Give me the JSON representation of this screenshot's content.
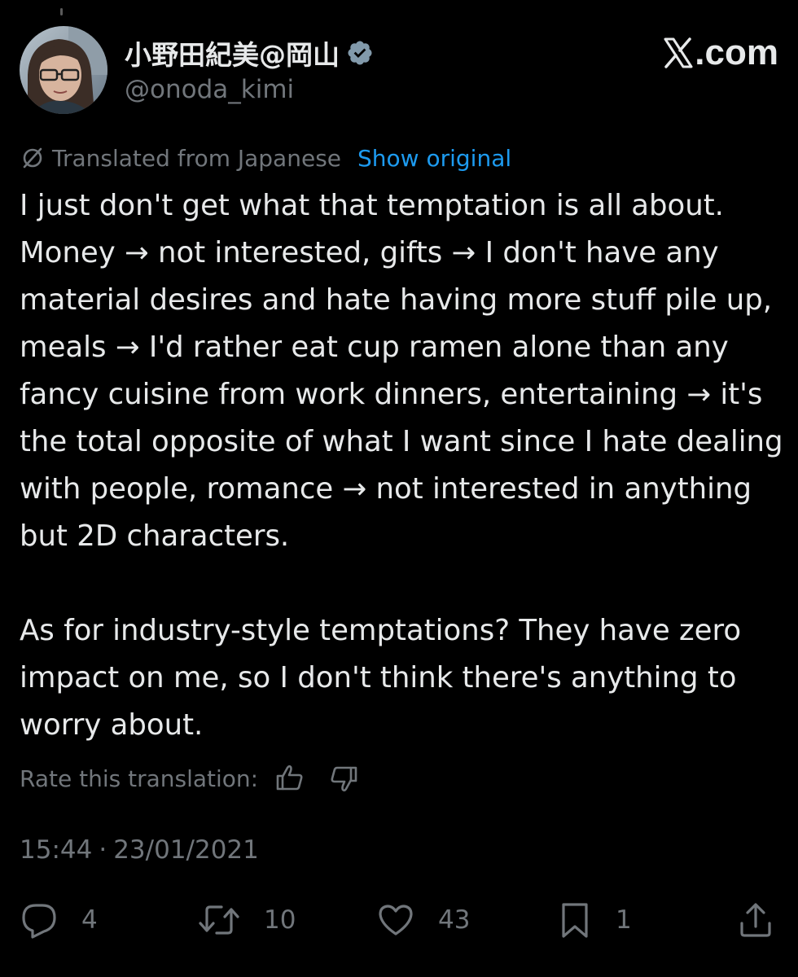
{
  "author": {
    "display_name": "小野田紀美@岡山",
    "handle": "@onoda_kimi",
    "verified": true
  },
  "brand": {
    "text": ".com"
  },
  "translation": {
    "notice": "Translated from Japanese",
    "show_original": "Show original",
    "rate_label": "Rate this translation:"
  },
  "tweet": {
    "paragraph_1": "I just don't get what that temptation is all about. Money → not interested, gifts → I don't have any material desires and hate having more stuff pile up, meals → I'd rather eat cup ramen alone than any fancy cuisine from work dinners, entertaining → it's the total opposite of what I want since I hate dealing with people, romance → not interested in anything but 2D characters.",
    "paragraph_2": "As for industry-style temptations? They have zero impact on me, so I don't think there's anything to worry about.",
    "time": "15:44",
    "separator": "·",
    "date": "23/01/2021"
  },
  "actions": {
    "replies": "4",
    "reposts": "10",
    "likes": "43",
    "bookmarks": "1"
  },
  "colors": {
    "background": "#000000",
    "text": "#e7e9ea",
    "secondary": "#71767b",
    "link": "#1d9bf0",
    "verified_badge": "#829aab"
  },
  "icons": [
    "verified-badge-icon",
    "x-logo-icon",
    "globe-slash-icon",
    "thumbs-up-icon",
    "thumbs-down-icon",
    "reply-icon",
    "retweet-icon",
    "heart-icon",
    "bookmark-icon",
    "share-icon"
  ]
}
